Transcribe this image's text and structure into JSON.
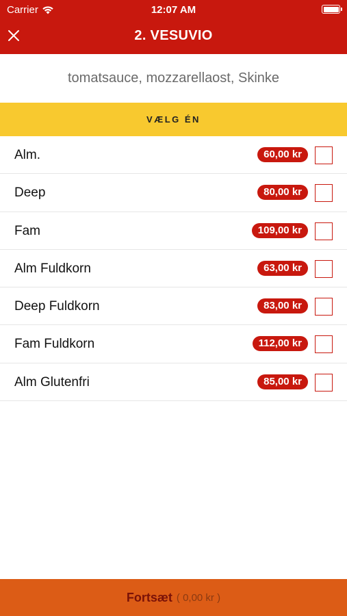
{
  "status_bar": {
    "carrier": "Carrier",
    "time": "12:07 AM",
    "wifi_icon": "wifi-icon",
    "battery_icon": "battery-icon"
  },
  "header": {
    "title": "2. VESUVIO",
    "close_icon": "close-icon"
  },
  "product": {
    "ingredients": "tomatsauce, mozzarellaost, Skinke"
  },
  "choose": {
    "label": "VÆLG ÉN"
  },
  "options": [
    {
      "name": "Alm.",
      "price": "60,00 kr",
      "checked": false
    },
    {
      "name": "Deep",
      "price": "80,00 kr",
      "checked": false
    },
    {
      "name": "Fam",
      "price": "109,00 kr",
      "checked": false
    },
    {
      "name": "Alm Fuldkorn",
      "price": "63,00 kr",
      "checked": false
    },
    {
      "name": "Deep Fuldkorn",
      "price": "83,00 kr",
      "checked": false
    },
    {
      "name": "Fam Fuldkorn",
      "price": "112,00 kr",
      "checked": false
    },
    {
      "name": "Alm Glutenfri",
      "price": "85,00 kr",
      "checked": false
    }
  ],
  "footer": {
    "label": "Fortsæt",
    "total": "( 0,00 kr )"
  },
  "colors": {
    "header": "#c8180e",
    "choose_bar": "#f8c92f",
    "footer": "#dc5c16",
    "price_badge": "#c8180e"
  }
}
